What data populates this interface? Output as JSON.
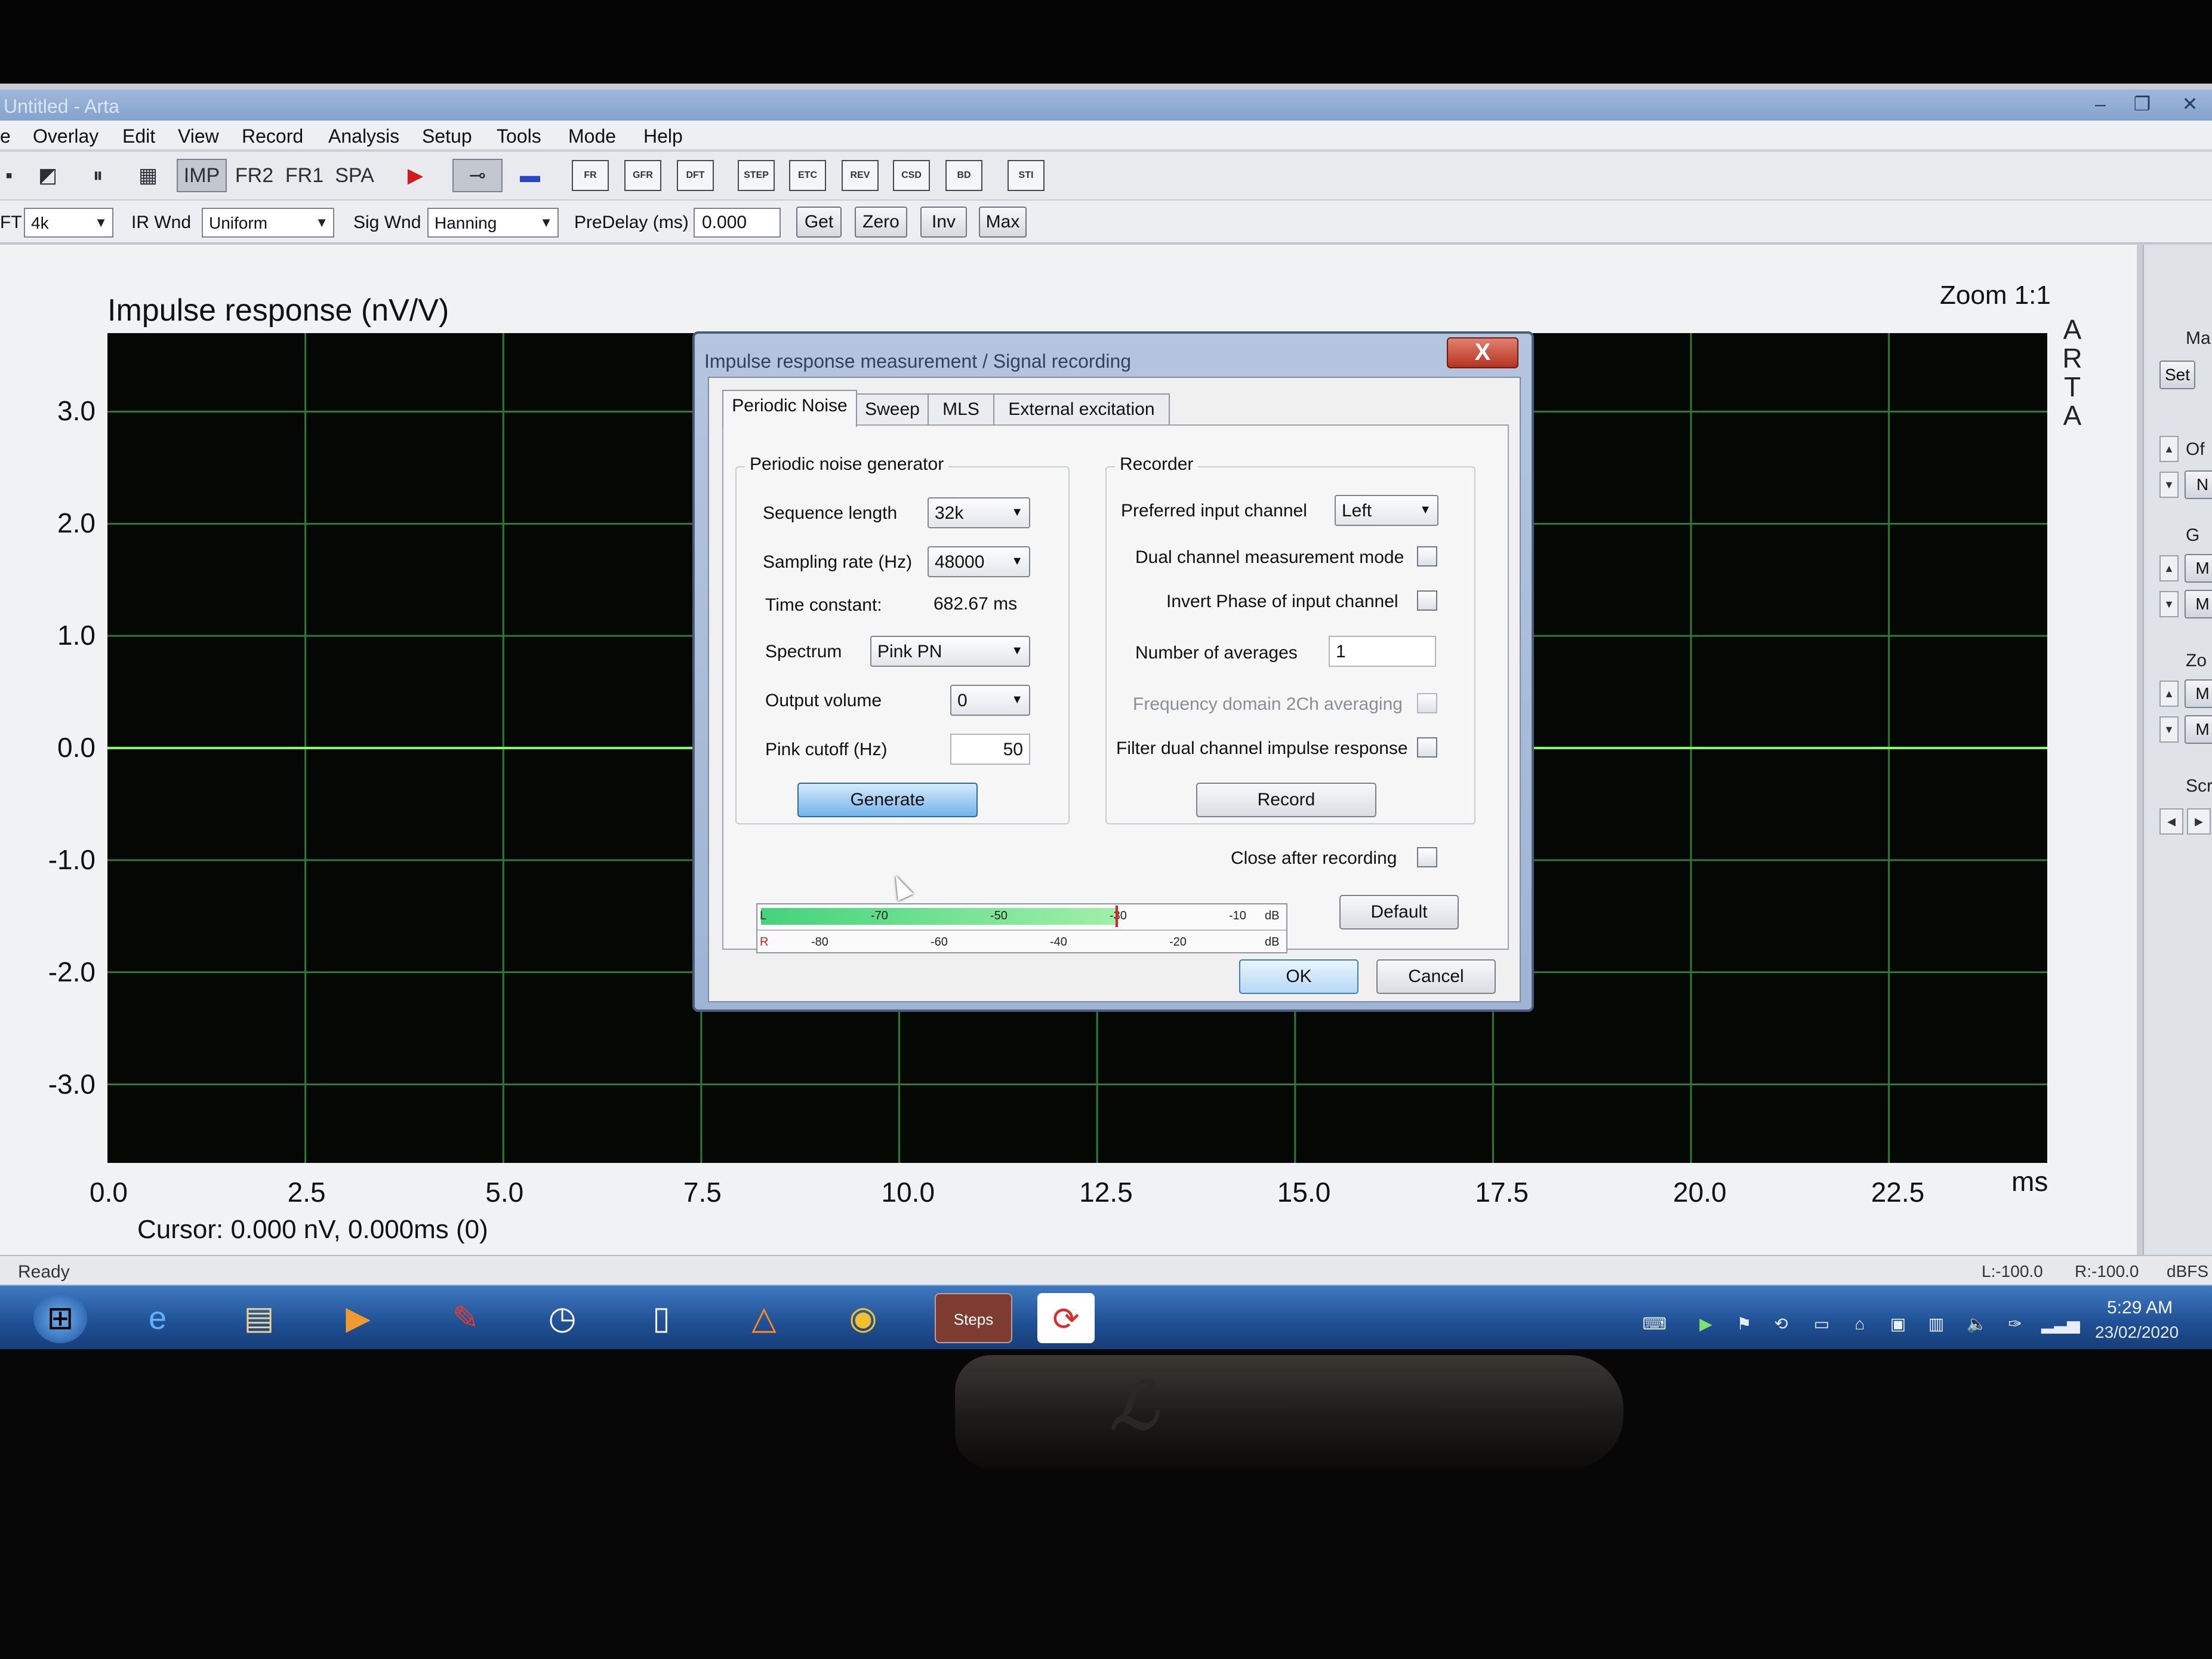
{
  "window": {
    "title": "Untitled - Arta",
    "minimize": "–",
    "maximize": "❐",
    "close": "✕"
  },
  "menu": [
    "e",
    "Overlay",
    "Edit",
    "View",
    "Record",
    "Analysis",
    "Setup",
    "Tools",
    "Mode",
    "Help"
  ],
  "toolbar": {
    "modes": [
      "IMP",
      "FR2",
      "FR1",
      "SPA"
    ],
    "active_mode": "IMP",
    "icons": [
      "FR",
      "GFR",
      "DFT",
      "STEP",
      "ETC",
      "REV",
      "CSD",
      "BD",
      "STI"
    ]
  },
  "options": {
    "fft_label": "FT",
    "fft_value": "4k",
    "ir_wnd_label": "IR Wnd",
    "ir_wnd_value": "Uniform",
    "sig_wnd_label": "Sig Wnd",
    "sig_wnd_value": "Hanning",
    "predelay_label": "PreDelay (ms)",
    "predelay_value": "0.000",
    "buttons": [
      "Get",
      "Zero",
      "Inv",
      "Max"
    ]
  },
  "plot": {
    "title": "Impulse response (nV/V)",
    "zoom": "Zoom 1:1",
    "vertical_brand": [
      "A",
      "R",
      "T",
      "A"
    ],
    "cursor_readout": "Cursor: 0.000 nV, 0.000ms (0)"
  },
  "chart_data": {
    "type": "line",
    "title": "Impulse response (nV/V)",
    "xlabel": "ms",
    "ylabel": "",
    "x_ticks": [
      "0.0",
      "2.5",
      "5.0",
      "7.5",
      "10.0",
      "12.5",
      "15.0",
      "17.5",
      "20.0",
      "22.5"
    ],
    "y_ticks": [
      "3.0",
      "2.0",
      "1.0",
      "0.0",
      "-1.0",
      "-2.0",
      "-3.0"
    ],
    "xlim": [
      0,
      24.5
    ],
    "ylim": [
      -3.7,
      3.7
    ],
    "grid": true,
    "series": [
      {
        "x": [
          0,
          24.5
        ],
        "y": [
          0,
          0
        ]
      }
    ]
  },
  "right_panel": {
    "labels": [
      "Ma",
      "Of",
      "G",
      "Zo",
      "Scr"
    ],
    "buttons": [
      "Set",
      "N",
      "M",
      "M",
      "M",
      "M"
    ]
  },
  "status": {
    "ready": "Ready",
    "left": "L:-100.0",
    "right": "R:-100.0",
    "unit": "dBFS"
  },
  "taskbar": {
    "apps": [
      "start",
      "ie",
      "explorer",
      "media",
      "pin",
      "clock",
      "blank",
      "vlc",
      "chrome",
      "Steps",
      "refresh"
    ],
    "time": "5:29 AM",
    "date": "23/02/2020"
  },
  "dialog": {
    "title": "Impulse response measurement / Signal recording",
    "close": "X",
    "tabs": [
      "Periodic Noise",
      "Sweep",
      "MLS",
      "External excitation"
    ],
    "active_tab": "Periodic Noise",
    "generator": {
      "group_title": "Periodic noise generator",
      "sequence_length_label": "Sequence length",
      "sequence_length": "32k",
      "sampling_rate_label": "Sampling rate (Hz)",
      "sampling_rate": "48000",
      "time_constant_label": "Time constant:",
      "time_constant": "682.67 ms",
      "spectrum_label": "Spectrum",
      "spectrum": "Pink PN",
      "output_volume_label": "Output volume",
      "output_volume": "0",
      "pink_cutoff_label": "Pink cutoff (Hz)",
      "pink_cutoff": "50",
      "generate": "Generate"
    },
    "recorder": {
      "group_title": "Recorder",
      "preferred_input_label": "Preferred input channel",
      "preferred_input": "Left",
      "dual_channel_label": "Dual channel measurement mode",
      "invert_phase_label": "Invert Phase of input channel",
      "averages_label": "Number of averages",
      "averages": "1",
      "freq_domain_label": "Frequency domain 2Ch averaging",
      "filter_dual_label": "Filter dual channel impulse response",
      "record": "Record"
    },
    "close_after_label": "Close after recording",
    "default": "Default",
    "ok": "OK",
    "cancel": "Cancel",
    "meter": {
      "left_label": "L",
      "right_label": "R",
      "top_ticks": [
        "-70",
        "-50",
        "-30",
        "-10",
        "dB"
      ],
      "bottom_ticks": [
        "-80",
        "-60",
        "-40",
        "-20",
        "dB"
      ],
      "left_fill_fraction": 0.68
    }
  }
}
